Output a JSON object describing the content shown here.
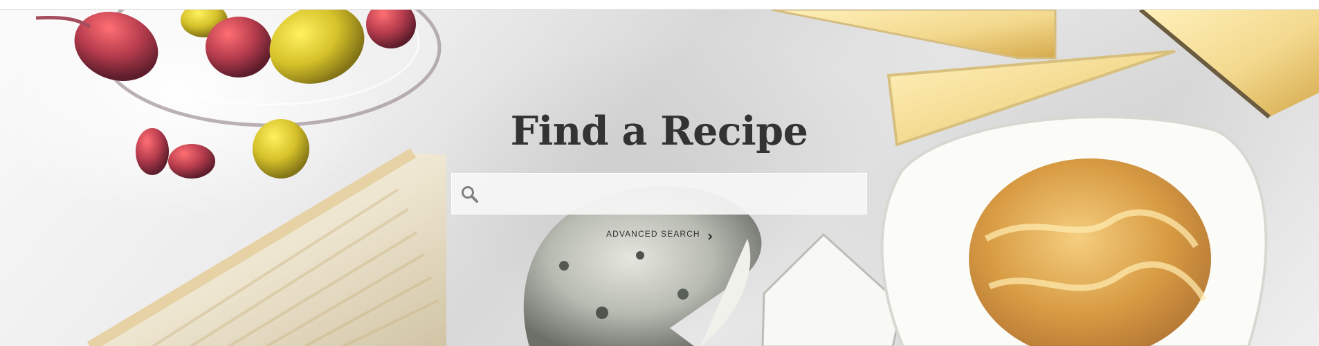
{
  "hero": {
    "title": "Find a Recipe",
    "background_description": "overhead photo of cheeses and olives on marble",
    "search": {
      "value": "",
      "placeholder": "",
      "icon": "search-icon"
    },
    "advanced_search": {
      "label": "ADVANCED SEARCH",
      "icon": "chevron-right-icon"
    }
  },
  "colors": {
    "page_background": "#ffffff",
    "title_text": "#333333",
    "search_background": "#f6f6f6",
    "search_icon": "#808080"
  }
}
